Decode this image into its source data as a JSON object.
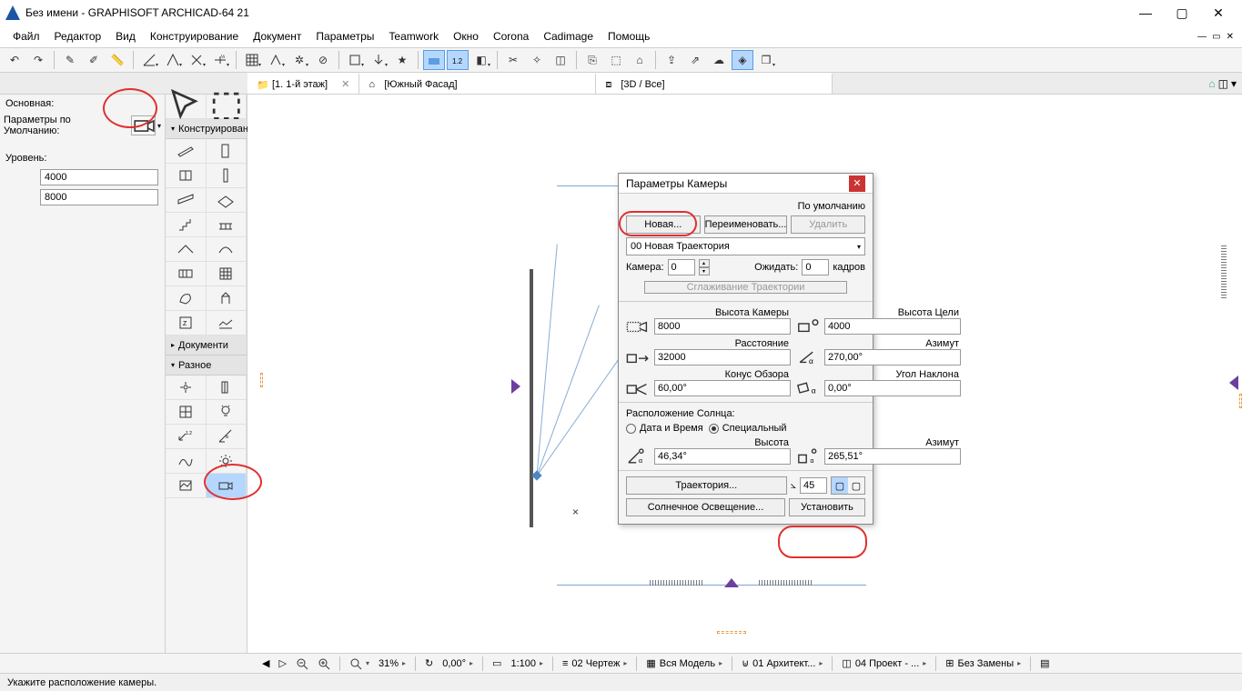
{
  "title": "Без имени - GRAPHISOFT ARCHICAD-64 21",
  "menu": [
    "Файл",
    "Редактор",
    "Вид",
    "Конструирование",
    "Документ",
    "Параметры",
    "Teamwork",
    "Окно",
    "Corona",
    "Cadimage",
    "Помощь"
  ],
  "tabs": {
    "t1": "[1. 1-й этаж]",
    "t2": "[Южный Фасад]",
    "t3": "[3D / Все]"
  },
  "leftpanel": {
    "basic": "Основная:",
    "defaults": "Параметры по Умолчанию:",
    "level": "Уровень:",
    "v1": "4000",
    "v2": "8000"
  },
  "toolpanel": {
    "construct": "Конструирование",
    "documents": "Документи",
    "misc": "Разное"
  },
  "dialog": {
    "title": "Параметры Камеры",
    "byDefault": "По умолчанию",
    "new": "Новая...",
    "rename": "Переименовать...",
    "delete": "Удалить",
    "trajectory": "00  Новая Траектория",
    "camera": "Камера:",
    "cameraVal": "0",
    "wait": "Ожидать:",
    "waitVal": "0",
    "frames": "кадров",
    "smooth": "Сглаживание Траектории",
    "camHeight": "Высота Камеры",
    "camHeightVal": "8000",
    "targHeight": "Высота Цели",
    "targHeightVal": "4000",
    "distance": "Расстояние",
    "distanceVal": "32000",
    "azimuth": "Азимут",
    "azimuthVal": "270,00°",
    "cone": "Конус Обзора",
    "coneVal": "60,00°",
    "tilt": "Угол Наклона",
    "tiltVal": "0,00°",
    "sunpos": "Расположение Солнца:",
    "datetime": "Дата и Время",
    "special": "Специальный",
    "sunHeight": "Высота",
    "sunHeightVal": "46,34°",
    "sunAzimuth": "Азимут",
    "sunAzimuthVal": "265,51°",
    "trajBtn": "Траектория...",
    "angle": "45",
    "sunlight": "Солнечное Освещение...",
    "apply": "Установить"
  },
  "quickbar": {
    "zoom": "31%",
    "angle": "0,00°",
    "scale": "1:100",
    "q1": "02 Чертеж",
    "q2": "Вся Модель",
    "q3": "01 Архитект...",
    "q4": "04 Проект - ...",
    "q5": "Без Замены"
  },
  "status": "Укажите расположение камеры."
}
